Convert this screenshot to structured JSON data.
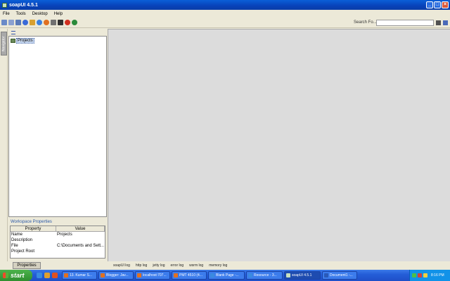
{
  "window": {
    "title": "soapUI 4.5.1"
  },
  "menu": [
    "File",
    "Tools",
    "Desktop",
    "Help"
  ],
  "toolbar": {
    "search_label": "Search Fo...",
    "search_value": ""
  },
  "navigator": {
    "tab_label": "Navigator",
    "tree_root": "Projects"
  },
  "workspace_properties": {
    "title": "Workspace Properties",
    "columns": [
      "Property",
      "Value"
    ],
    "rows": [
      {
        "name": "Name",
        "value": "Projects"
      },
      {
        "name": "Description",
        "value": ""
      },
      {
        "name": "File",
        "value": "C:\\Documents and Sett..."
      },
      {
        "name": "Project Root",
        "value": ""
      }
    ],
    "bottom_tab": "Properties"
  },
  "logs": [
    "soapUI log",
    "http log",
    "jetty log",
    "error log",
    "wsrm log",
    "memory log"
  ],
  "taskbar": {
    "start": "start",
    "tasks": [
      {
        "label": "13. Kumar S..."
      },
      {
        "label": "Blogger: Jav..."
      },
      {
        "label": "localhost:707..."
      },
      {
        "label": "PMT 4510 (4..."
      },
      {
        "label": "Blank Page -..."
      },
      {
        "label": "Resource - 3..."
      },
      {
        "label": "soapUI 4.5.1"
      },
      {
        "label": "Document1 -..."
      }
    ],
    "clock": "8:16 PM"
  },
  "colors": {
    "titlebar": "#0a4fc8",
    "desktop": "#dcdcdc",
    "taskbar": "#245ed8",
    "start": "#3a9a3a"
  }
}
